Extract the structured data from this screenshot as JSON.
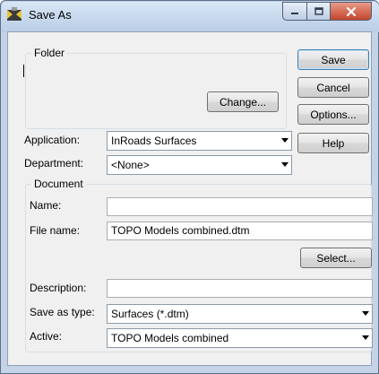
{
  "window": {
    "title": "Save As"
  },
  "folder": {
    "legend": "Folder",
    "path": "",
    "change_label": "Change..."
  },
  "buttons": {
    "save": "Save",
    "cancel": "Cancel",
    "options": "Options...",
    "help": "Help",
    "select": "Select..."
  },
  "application": {
    "label": "Application:",
    "value": "InRoads Surfaces"
  },
  "department": {
    "label": "Department:",
    "value": "<None>"
  },
  "document": {
    "legend": "Document",
    "name": {
      "label": "Name:",
      "value": ""
    },
    "file_name": {
      "label": "File name:",
      "value": "TOPO Models combined.dtm"
    },
    "description": {
      "label": "Description:",
      "value": ""
    },
    "save_as_type": {
      "label": "Save as type:",
      "value": "Surfaces (*.dtm)"
    },
    "active": {
      "label": "Active:",
      "value": "TOPO Models combined"
    }
  },
  "icons": {
    "app": "save-as-app-icon",
    "minimize": "minimize-icon",
    "maximize": "maximize-icon",
    "close": "close-icon",
    "dropdown": "chevron-down-icon"
  },
  "colors": {
    "title_bar": "#c4d3e6",
    "close_button": "#c4452c",
    "client_bg": "#f0f0f0"
  }
}
